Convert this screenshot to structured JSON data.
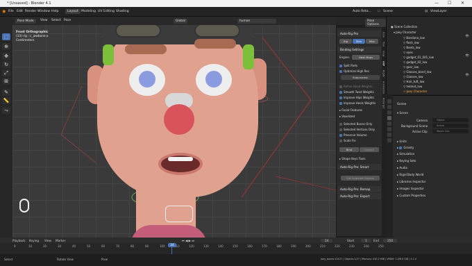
{
  "window": {
    "title": "* [Unsaved] - Blender 4.1",
    "minimize": "—",
    "maximize": "☐",
    "close": "✕"
  },
  "menubar": {
    "menus": [
      "File",
      "Edit",
      "Render",
      "Window",
      "Help"
    ],
    "workspaces": [
      "Layout",
      "Modeling",
      "UV Editing",
      "Shading"
    ],
    "active_workspace": "Layout",
    "addon_label": "Auto Reta...",
    "scene": "Scene",
    "view_layer": "ViewLayer"
  },
  "viewport_header": {
    "mode": "Pose Mode",
    "menus": [
      "View",
      "Select",
      "Pose"
    ],
    "orientation": "Global",
    "search_value": "human",
    "pose_options": "Pose Options"
  },
  "viewport_info": {
    "line1": "Front Orthographic",
    "line2": "(33) rig : c_jawbone.x",
    "line3": "Centimeters"
  },
  "npanel": {
    "title": "Auto-Rig Pro",
    "tabs": [
      "Rig",
      "Skin",
      "Misc"
    ],
    "active_tab": "Skin",
    "binding_settings": "Binding Settings",
    "engine_label": "Engine:",
    "engine_value": "Heat Maps",
    "options": [
      {
        "label": "Split Parts",
        "checked": true
      },
      {
        "label": "Optimize High Res",
        "checked": true
      },
      {
        "label": "Refine Head Weights",
        "checked": false
      },
      {
        "label": "Smooth Twist Weights",
        "checked": true
      },
      {
        "label": "Improve Hips Weights",
        "checked": true
      },
      {
        "label": "Improve Heels Weights",
        "checked": true
      }
    ],
    "subprocess_label": "Subprocess",
    "facial_features": "Facial Features",
    "voxelized": "Voxelized",
    "more_options": [
      {
        "label": "Selected Bones Only",
        "checked": false
      },
      {
        "label": "Selected Vertices Only",
        "checked": false
      },
      {
        "label": "Preserve Volume",
        "checked": true
      },
      {
        "label": "Scale Fix",
        "checked": false
      }
    ],
    "bind_button": "Bind",
    "unbind_button": "Unbind",
    "shape_keys_tools": "Shape Keys Tools",
    "smart_header": "Auto-Rig Pro: Smart",
    "get_button": "Get Selected Objects",
    "remap_header": "Auto-Rig Pro: Remap",
    "export_header": "Auto-Rig Pro: Export"
  },
  "side_tabs": [
    "Item",
    "Tool",
    "View",
    "ARP",
    "Rigify",
    "Animation",
    "Retarget"
  ],
  "outliner": {
    "root": "Scene Collection",
    "collection": "Joey Character",
    "items": [
      "Bandana_low",
      "flesh_low",
      "Boots_low",
      "eyes",
      "gadget_01_001_low",
      "gadget_02_low",
      "gear_low",
      "Glasses_band_low",
      "Glasses_low",
      "Hair_tuft_low",
      "helmet_low",
      "Joey Character"
    ]
  },
  "properties": {
    "scene_title": "Scene",
    "section_scene": "Scene",
    "camera_label": "Camera",
    "camera_value": "Object",
    "background_label": "Background Scene",
    "background_value": "Scene",
    "active_clip_label": "Active Clip",
    "active_clip_value": "Movie Clip",
    "sections": [
      "Units",
      "Gravity",
      "Simulation",
      "Keying Sets",
      "Audio",
      "Rigid Body World",
      "Libraries Inspector",
      "Images Inspector",
      "Custom Properties"
    ]
  },
  "timeline": {
    "menus": [
      "Playback",
      "Keying",
      "View",
      "Marker"
    ],
    "ticks": [
      "0",
      "10",
      "20",
      "30",
      "40",
      "50",
      "60",
      "70",
      "80",
      "90",
      "100",
      "110",
      "120",
      "130",
      "140",
      "150",
      "160",
      "170",
      "180",
      "190",
      "200",
      "210",
      "220",
      "230",
      "240",
      "250"
    ],
    "current_frame": "24",
    "start_label": "Start",
    "start": "1",
    "end_label": "End",
    "end": "250",
    "frame_box": "24"
  },
  "statusbar": {
    "left1": "Select",
    "left2": "Rotate View",
    "left3": "Pose",
    "right": "Joey_bones:12427 | Objects:1/27 | Memory: 410.2 MiB | VRAM: 1.4/8.0 GiB | 4.1.0"
  },
  "colors": {
    "accent": "#4772b3",
    "skin": "#e0a28f",
    "nose": "#d9545a",
    "iris": "#8a9be0",
    "hair": "#6fbf3a"
  }
}
